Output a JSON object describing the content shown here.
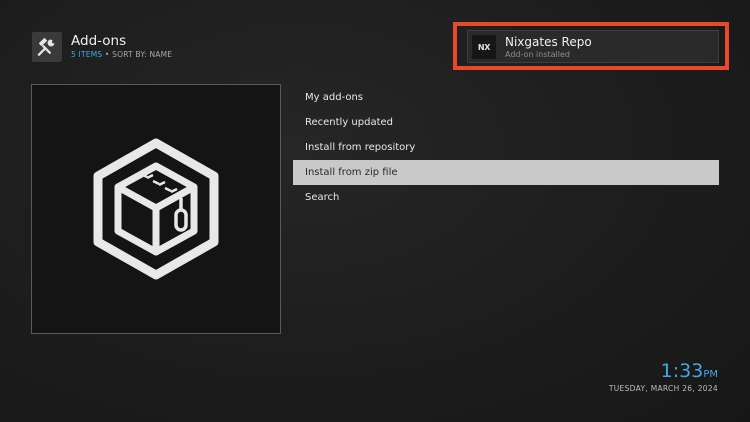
{
  "header": {
    "icon": "tools-icon",
    "title": "Add-ons",
    "item_count": "5 ITEMS",
    "separator": "•",
    "sort": "SORT BY: NAME"
  },
  "notification": {
    "logo_text": "NX",
    "title": "Nixgates Repo",
    "subtitle": "Add-on installed",
    "highlight_color": "#e8492a"
  },
  "poster": {
    "icon": "zip-box-icon"
  },
  "menu": {
    "items": [
      {
        "label": "My add-ons"
      },
      {
        "label": "Recently updated"
      },
      {
        "label": "Install from repository"
      },
      {
        "label": "Install from zip file",
        "selected": true
      },
      {
        "label": "Search"
      }
    ]
  },
  "clock": {
    "time": "1:33",
    "ampm": "PM",
    "date": "TUESDAY, MARCH 26, 2024"
  },
  "colors": {
    "accent": "#3fa9e0",
    "selection": "#c9c9c9",
    "background": "#1c1c1c"
  }
}
